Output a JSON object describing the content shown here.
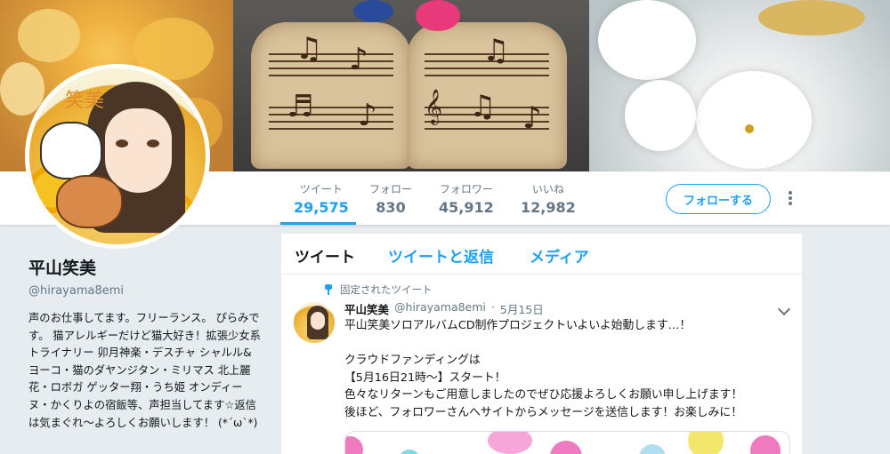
{
  "nav": {
    "stats": [
      {
        "label": "ツイート",
        "value": "29,575"
      },
      {
        "label": "フォロー",
        "value": "830"
      },
      {
        "label": "フォロワー",
        "value": "45,912"
      },
      {
        "label": "いいね",
        "value": "12,982"
      }
    ],
    "follow_button": "フォローする"
  },
  "avatar": {
    "text": "笑美"
  },
  "profile": {
    "name": "平山笑美",
    "handle": "@hirayama8emi",
    "bio": "声のお仕事してます。フリーランス。 ぴらみです。 猫アレルギーだけど猫大好き！拡張少女系トライナリー 卯月神楽・デスチャ シャルル&ヨーコ・猫のダヤンジタン・ミリマス 北上麗花・ロボガ ゲッター翔・うち姫 オンディーヌ・かくりよの宿飯等、声担当してます☆返信は気まぐれ〜よろしくお願いします！ (*´ω`*)"
  },
  "timeline": {
    "tabs": [
      "ツイート",
      "ツイートと返信",
      "メディア"
    ],
    "pinned_label": "固定されたツイート",
    "tweet": {
      "name": "平山笑美",
      "handle": "@hirayama8emi",
      "dot": "·",
      "date": "5月15日",
      "lines": [
        "平山笑美ソロアルバムCD制作プロジェクトいよいよ始動します…！",
        "",
        "クラウドファンディングは",
        "【5月16日21時〜】スタート！",
        "色々なリターンもご用意しましたのでぜひ応援よろしくお願い申し上げます！",
        "後ほど、フォロワーさんへサイトからメッセージを送信します！お楽しみに！"
      ]
    }
  },
  "colors": {
    "accent": "#1da1f2",
    "secondary_text": "#657786",
    "background": "#e6ecf0"
  }
}
